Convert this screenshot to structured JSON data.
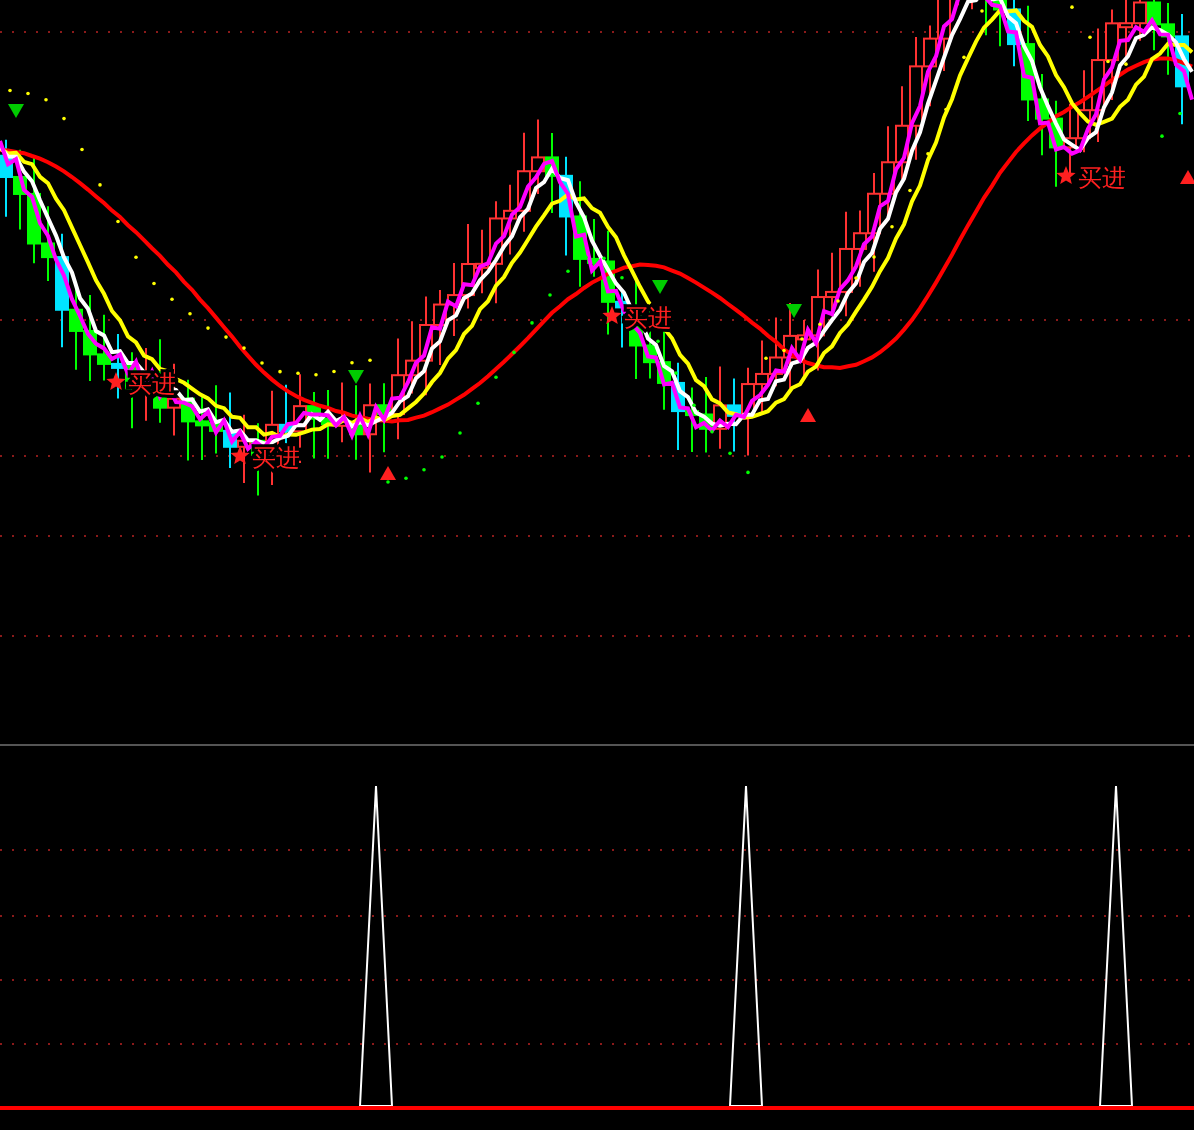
{
  "price_panel": {
    "signals": [
      {
        "label": "买进"
      },
      {
        "label": "买进"
      },
      {
        "label": "买进"
      },
      {
        "label": "买进"
      }
    ]
  }
}
